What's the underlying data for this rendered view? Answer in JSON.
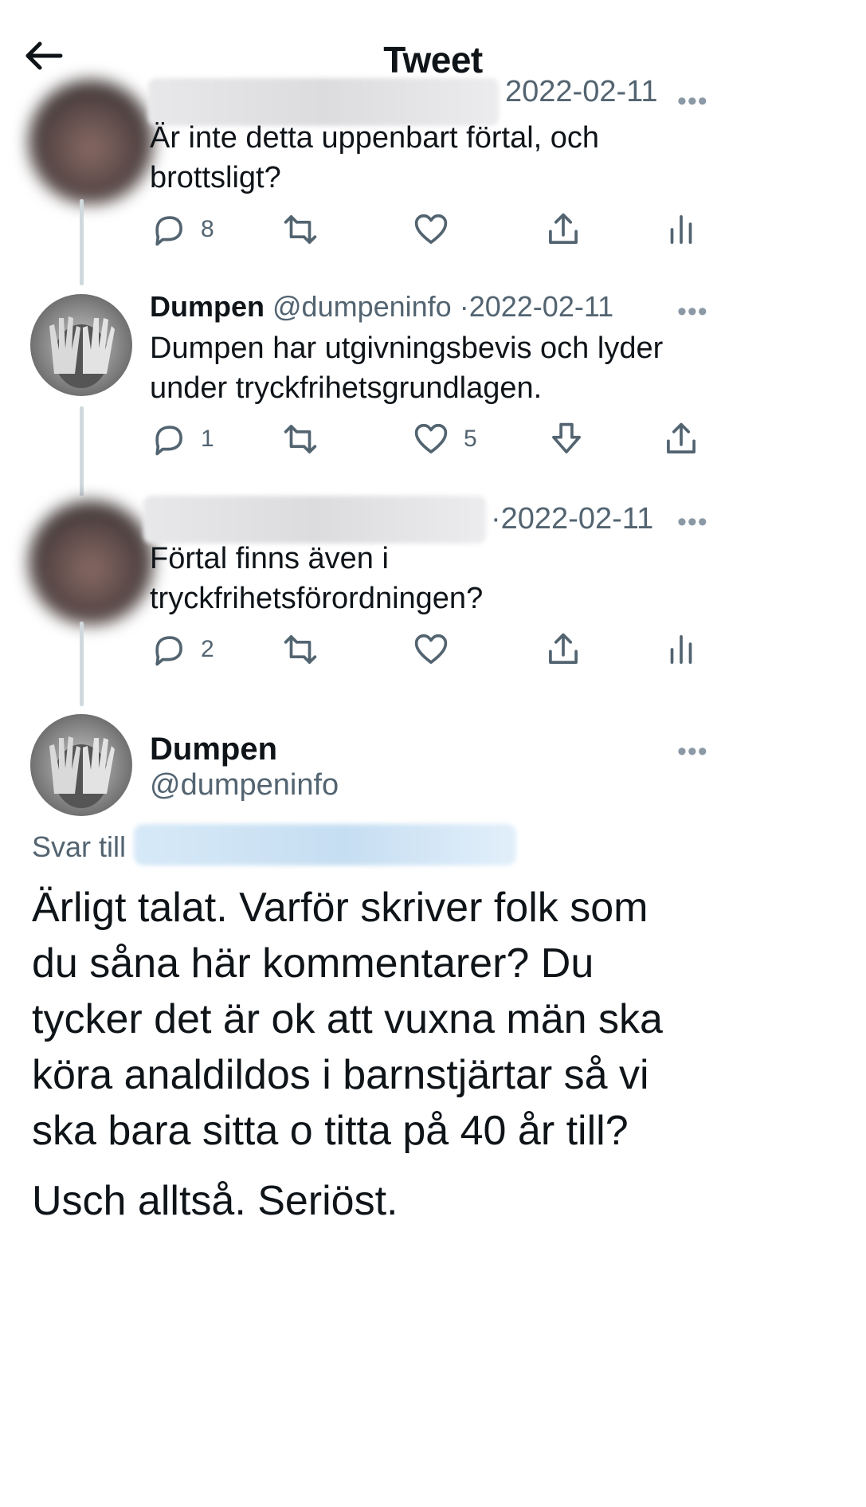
{
  "header": {
    "title": "Tweet"
  },
  "replies": [
    {
      "date": "2022-02-11",
      "text": [
        "Är inte detta uppenbart förtal, och",
        "brottsligt?"
      ],
      "reply_count": "8"
    },
    {
      "name": "Dumpen",
      "handle": "@dumpeninfo",
      "separator": "·",
      "date": "2022-02-11",
      "text": [
        "Dumpen har utgivningsbevis och lyder",
        "under tryckfrihetsgrundlagen."
      ],
      "reply_count": "1",
      "like_count": "5"
    },
    {
      "separator": "·",
      "date": "2022-02-11",
      "text": [
        "Förtal finns även i",
        "tryckfrihetsförordningen?"
      ],
      "reply_count": "2"
    }
  ],
  "main_tweet": {
    "name": "Dumpen",
    "handle": "@dumpeninfo",
    "reply_label": "Svar till",
    "text": [
      "Ärligt talat. Varför skriver folk som",
      "du såna här kommentarer? Du",
      "tycker det är ok att vuxna män ska",
      "köra analdildos i barnstjärtar så vi",
      "ska bara sitta o titta på 40 år till?"
    ],
    "text2": "Usch alltså. Seriöst."
  },
  "more_glyph": "•••",
  "colors": {
    "secondary": "#536471",
    "thread_line": "#cfd9de"
  },
  "icons": [
    "back-arrow-icon",
    "reply-icon",
    "retweet-icon",
    "like-icon",
    "share-icon",
    "analytics-icon",
    "downvote-icon"
  ]
}
